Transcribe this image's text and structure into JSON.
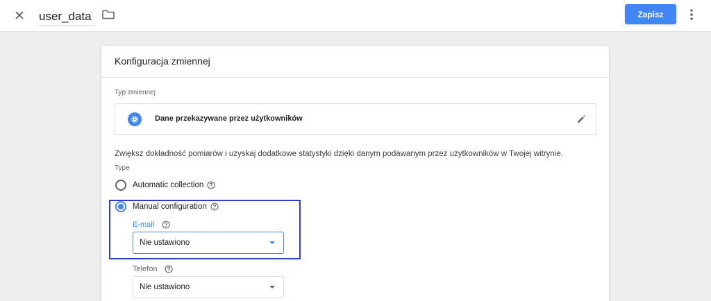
{
  "topbar": {
    "name_value": "user_data",
    "save_label": "Zapisz"
  },
  "card": {
    "title": "Konfiguracja zmiennej",
    "type_label": "Typ zmiennej",
    "type_name": "Dane przekazywane przez użytkowników",
    "description": "Zwiększ dokładność pomiarów i uzyskaj dodatkowe statystyki dzięki danym podawanym przez użytkowników w Twojej witrynie.",
    "section_label": "Type",
    "options": [
      {
        "label": "Automatic collection",
        "selected": false
      },
      {
        "label": "Manual configuration",
        "selected": true
      }
    ],
    "fields": [
      {
        "label": "E-mail",
        "value": "Nie ustawiono",
        "label_color": "#4285f4"
      },
      {
        "label": "Telefon",
        "value": "Nie ustawiono",
        "label_color": "#5f6368"
      }
    ]
  },
  "colors": {
    "accent": "#4285f4",
    "highlight": "#2b3bd6"
  }
}
